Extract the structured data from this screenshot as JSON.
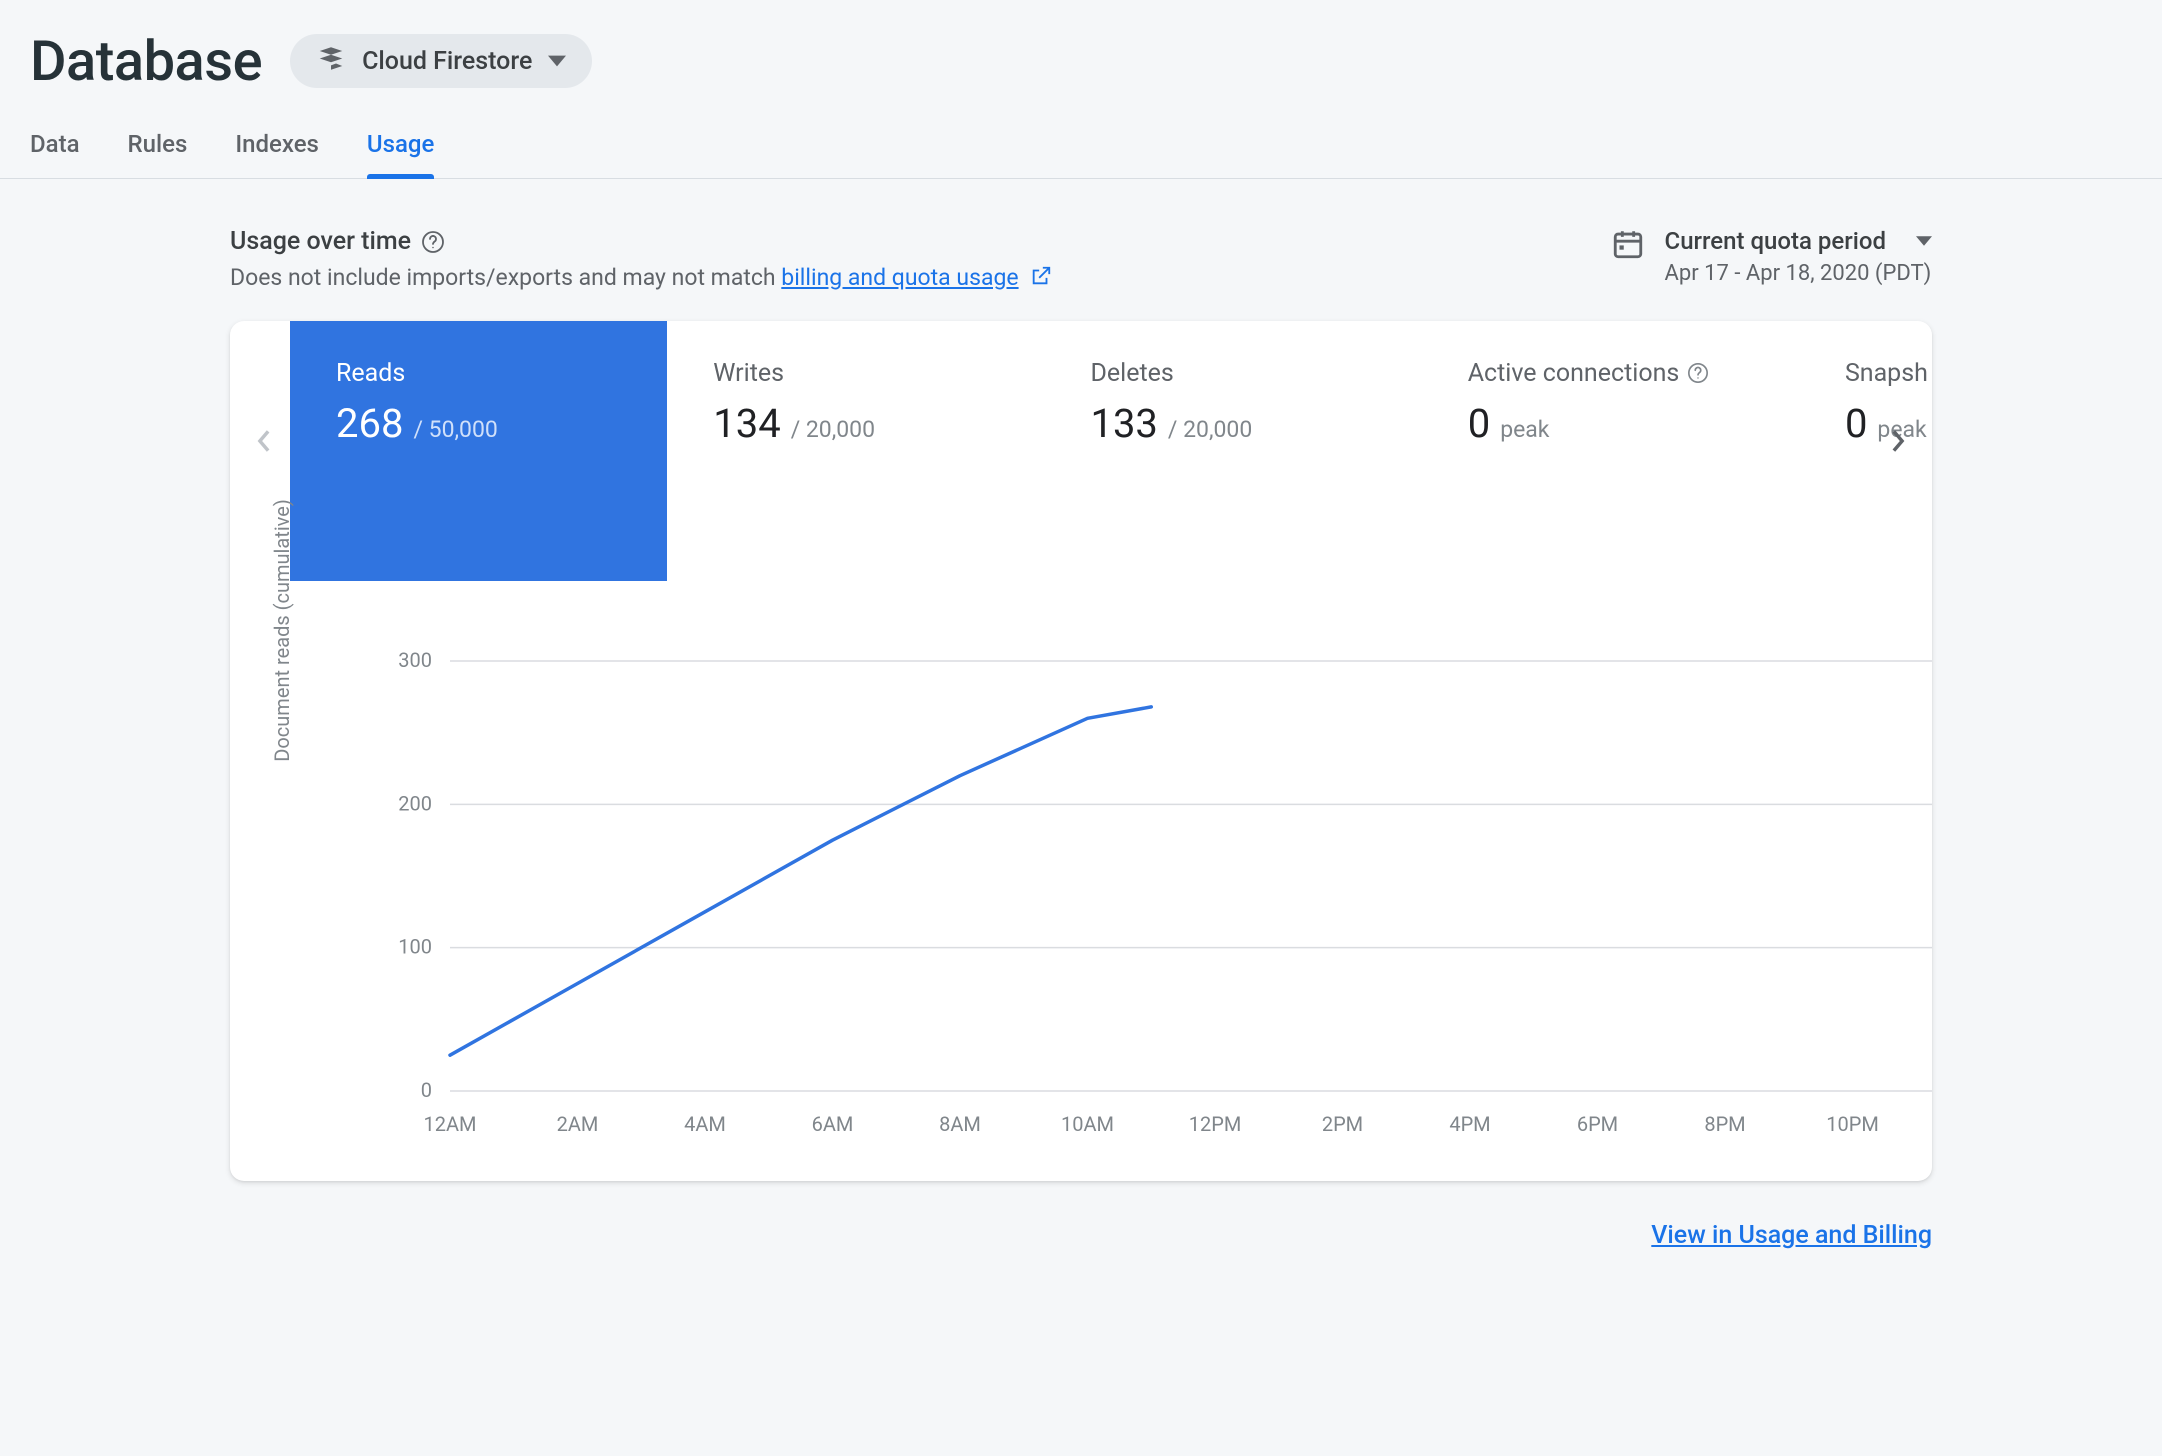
{
  "header": {
    "title": "Database",
    "selector_label": "Cloud Firestore"
  },
  "tabs": [
    {
      "label": "Data",
      "active": false
    },
    {
      "label": "Rules",
      "active": false
    },
    {
      "label": "Indexes",
      "active": false
    },
    {
      "label": "Usage",
      "active": true
    }
  ],
  "usage_section": {
    "title": "Usage over time",
    "subtitle_prefix": "Does not include imports/exports and may not match ",
    "subtitle_link": "billing and quota usage"
  },
  "period": {
    "label": "Current quota period",
    "range": "Apr 17 - Apr 18, 2020 (PDT)"
  },
  "metrics": [
    {
      "title": "Reads",
      "value": "268",
      "limit": "/ 50,000",
      "active": true
    },
    {
      "title": "Writes",
      "value": "134",
      "limit": "/ 20,000",
      "active": false
    },
    {
      "title": "Deletes",
      "value": "133",
      "limit": "/ 20,000",
      "active": false
    },
    {
      "title": "Active connections",
      "value": "0",
      "suffix": "peak",
      "has_help": true,
      "active": false
    },
    {
      "title": "Snapshot listeners",
      "value": "0",
      "suffix": "peak",
      "active": false,
      "truncated": true
    }
  ],
  "chart_data": {
    "type": "line",
    "title": "",
    "xlabel": "",
    "ylabel": "Document reads (cumulative)",
    "ylim": [
      0,
      300
    ],
    "yticks": [
      0,
      100,
      200,
      300
    ],
    "categories": [
      "12AM",
      "2AM",
      "4AM",
      "6AM",
      "8AM",
      "10AM",
      "12PM",
      "2PM",
      "4PM",
      "6PM",
      "8PM",
      "10PM",
      "12AM"
    ],
    "series": [
      {
        "name": "Reads",
        "color": "#3074e0",
        "values": [
          25,
          75,
          125,
          175,
          220,
          260,
          268,
          null,
          null,
          null,
          null,
          null,
          null
        ]
      }
    ],
    "x_hours": [
      0,
      2,
      4,
      6,
      8,
      10,
      11
    ],
    "y_values": [
      25,
      75,
      125,
      175,
      220,
      260,
      268
    ]
  },
  "footer": {
    "link_text": "View in Usage and Billing"
  }
}
